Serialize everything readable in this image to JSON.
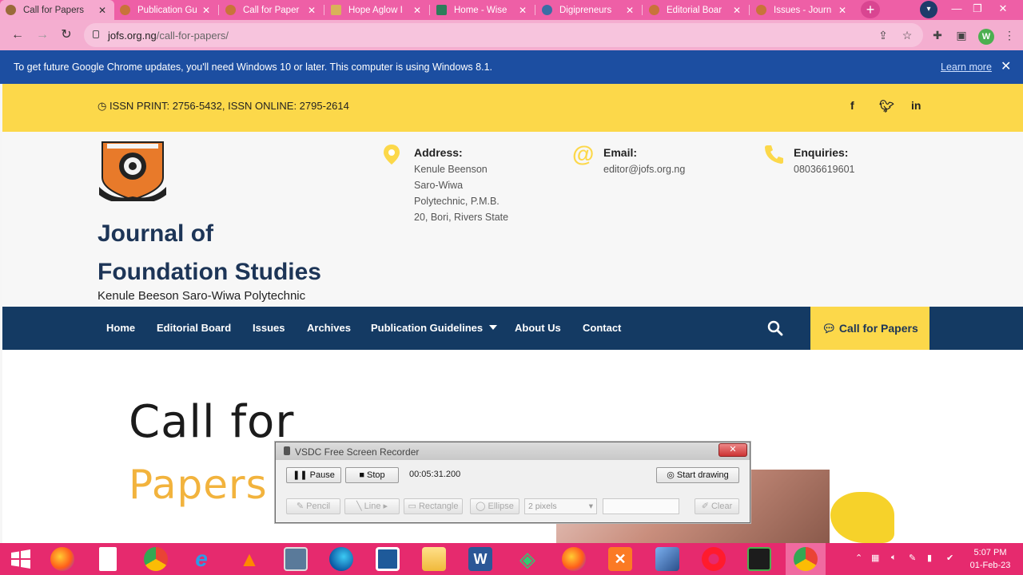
{
  "browser": {
    "tabs": [
      {
        "title": "Call for Papers",
        "favicon_color": "#9a6a3a",
        "active": true
      },
      {
        "title": "Publication Gu",
        "favicon_color": "#c9733a",
        "active": false
      },
      {
        "title": "Call for Paper",
        "favicon_color": "#c9733a",
        "active": false
      },
      {
        "title": "Hope Aglow I",
        "favicon_color": "#d9b25a",
        "active": false
      },
      {
        "title": "Home - Wise",
        "favicon_color": "#2e7d5b",
        "active": false
      },
      {
        "title": "Digipreneurs",
        "favicon_color": "#3a6ea5",
        "active": false
      },
      {
        "title": "Editorial Boar",
        "favicon_color": "#c9733a",
        "active": false
      },
      {
        "title": "Issues - Journ",
        "favicon_color": "#c9733a",
        "active": false
      }
    ],
    "url_host": "jofs.org.ng",
    "url_path": "/call-for-papers/",
    "profile_initial": "W",
    "infobar": {
      "message": "To get future Google Chrome updates, you'll need Windows 10 or later. This computer is using Windows 8.1.",
      "link": "Learn more"
    }
  },
  "site": {
    "issn": "ISSN PRINT: 2756-5432, ISSN ONLINE: 2795-2614",
    "social": [
      "f",
      "t",
      "in"
    ],
    "title_line1": "Journal of",
    "title_line2": "Foundation Studies",
    "subtitle": "Kenule Beeson Saro-Wiwa Polytechnic",
    "address": {
      "label": "Address:",
      "lines": [
        "Kenule Beenson",
        "Saro-Wiwa",
        "Polytechnic, P.M.B.",
        "20, Bori, Rivers State"
      ]
    },
    "email": {
      "label": "Email:",
      "value": "editor@jofs.org.ng"
    },
    "enquiries": {
      "label": "Enquiries:",
      "value": "08036619601"
    },
    "nav": [
      "Home",
      "Editorial Board",
      "Issues",
      "Archives",
      "Publication Guidelines",
      "About Us",
      "Contact"
    ],
    "cta": "Call for Papers",
    "hero_line1": "Call for",
    "hero_line2": "Papers",
    "accent": "#fcd84a",
    "navy": "#143a63"
  },
  "recorder": {
    "title": "VSDC Free Screen Recorder",
    "pause": "Pause",
    "stop": "Stop",
    "time": "00:05:31.200",
    "start_drawing": "Start drawing",
    "tools": [
      "Pencil",
      "Line",
      "Rectangle",
      "Ellipse"
    ],
    "pen_size": "2 pixels",
    "clear": "Clear"
  },
  "taskbar": {
    "clock_time": "5:07 PM",
    "clock_date": "01-Feb-23"
  }
}
